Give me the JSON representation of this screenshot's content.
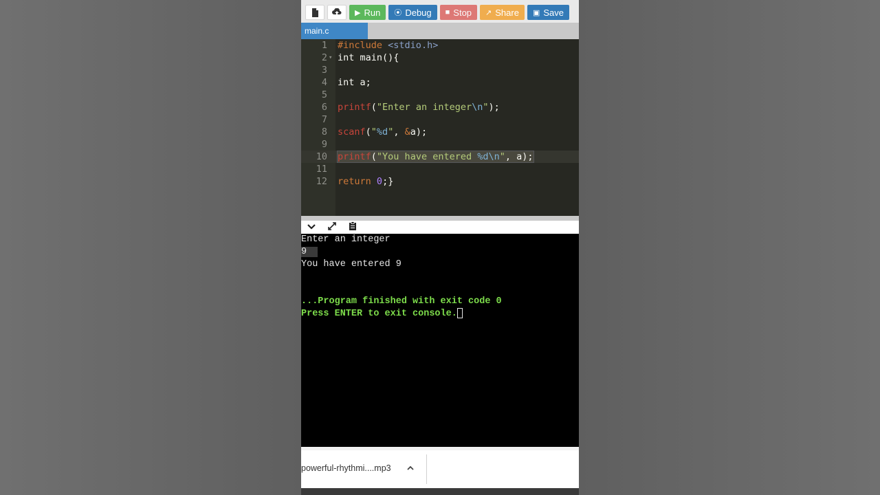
{
  "toolbar": {
    "new_icon": "file-icon",
    "upload_icon": "cloud-upload-icon",
    "run_label": "Run",
    "debug_label": "Debug",
    "stop_label": "Stop",
    "share_label": "Share",
    "save_label": "Save"
  },
  "tabs": [
    {
      "label": "main.c",
      "active": true
    }
  ],
  "editor": {
    "language": "C",
    "line_numbers": [
      "1",
      "2",
      "3",
      "4",
      "5",
      "6",
      "7",
      "8",
      "9",
      "10",
      "11",
      "12"
    ],
    "active_line": 10
  },
  "console": {
    "lines": [
      "Enter an integer",
      "9",
      "You have entered 9",
      "",
      "",
      "...Program finished with exit code 0",
      "Press ENTER to exit console."
    ]
  },
  "download": {
    "file_name": "powerful-rhythmi....mp3"
  },
  "colors": {
    "run": "#5cb85c",
    "debug": "#337ab7",
    "stop": "#d9534f",
    "share": "#f0ad4e",
    "save": "#337ab7",
    "tab_active": "#3f87c6",
    "editor_bg": "#272822",
    "console_bg": "#000000",
    "console_status": "#7ddc4b"
  }
}
